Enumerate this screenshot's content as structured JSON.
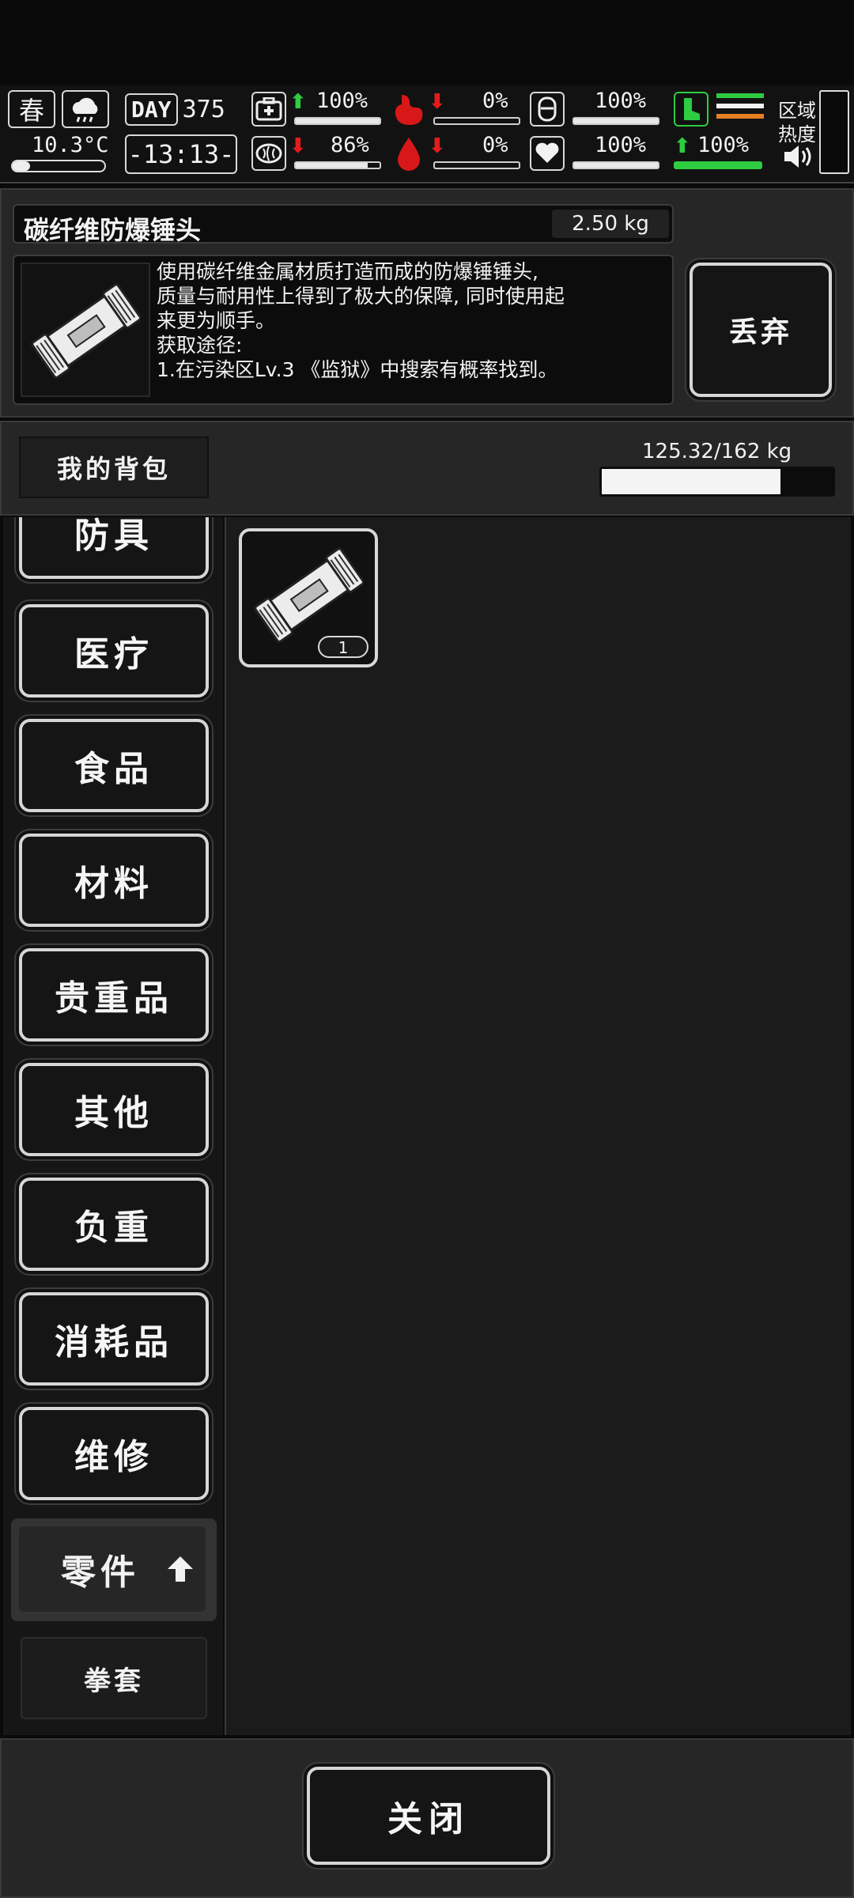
{
  "status_bar": {
    "season": "春",
    "temperature": "10.3°C",
    "day_label": "DAY",
    "day": "375",
    "time": "-13:13-",
    "health_pct": "100%",
    "brain_pct": "86%",
    "stomach_pct": "0%",
    "blood_pct": "0%",
    "water_pct": "100%",
    "heart_pct": "100%",
    "stamina_pct": "100%",
    "zone_heat_label_1": "区域",
    "zone_heat_label_2": "热度",
    "values": {
      "health": 1.0,
      "brain": 0.86,
      "stomach": 0.0,
      "blood": 0.0,
      "water": 1.0,
      "heart": 1.0,
      "stamina": 1.0
    },
    "colors": {
      "good": "#2ecc40",
      "bad": "#e51b1b",
      "orange": "#e67e22"
    }
  },
  "item_detail": {
    "name": "碳纤维防爆锤头",
    "weight": "2.50 kg",
    "description_lines": [
      "使用碳纤维金属材质打造而成的防爆锤锤头,",
      "质量与耐用性上得到了极大的保障, 同时使用起",
      "来更为顺手。",
      "获取途径:",
      "1.在污染区Lv.3 《监狱》中搜索有概率找到。"
    ],
    "discard_label": "丢弃",
    "icon": "hammer-head-icon"
  },
  "backpack": {
    "title": "我的背包",
    "capacity": "125.32/162 kg",
    "fill_fraction": 0.7736
  },
  "categories": [
    {
      "label": "防具"
    },
    {
      "label": "医疗"
    },
    {
      "label": "食品"
    },
    {
      "label": "材料"
    },
    {
      "label": "贵重品"
    },
    {
      "label": "其他"
    },
    {
      "label": "负重"
    },
    {
      "label": "消耗品"
    },
    {
      "label": "维修"
    },
    {
      "label": "零件",
      "selected": true
    },
    {
      "label": "拳套"
    }
  ],
  "inventory": [
    {
      "icon": "hammer-head-icon",
      "count": "1"
    }
  ],
  "footer": {
    "close_label": "关闭"
  }
}
